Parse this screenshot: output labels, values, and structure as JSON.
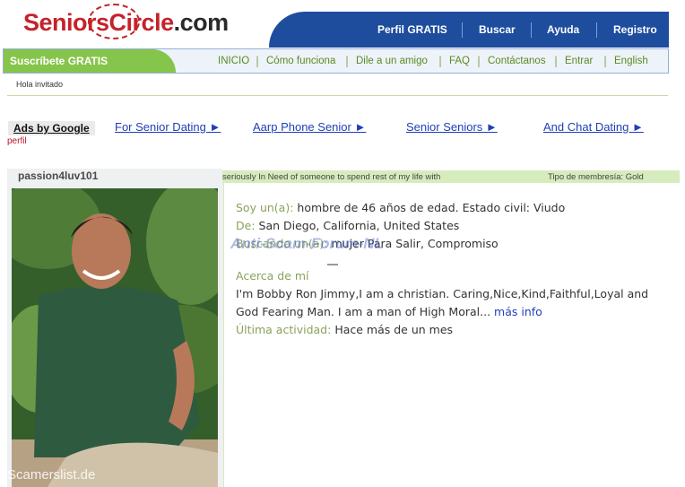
{
  "header": {
    "logo": {
      "part1": "Seniors",
      "part2": "Circle",
      "part3": ".com"
    },
    "nav": [
      {
        "label": "Perfil GRATIS"
      },
      {
        "label": "Buscar"
      },
      {
        "label": "Ayuda"
      },
      {
        "label": "Registro"
      }
    ]
  },
  "subnav": {
    "subscribe": "Suscríbete GRATIS",
    "items": [
      {
        "label": "INICIO"
      },
      {
        "label": "Cómo funciona"
      },
      {
        "label": "Dile a un amigo"
      },
      {
        "label": "FAQ"
      },
      {
        "label": "Contáctanos"
      },
      {
        "label": "Entrar"
      },
      {
        "label": "English"
      }
    ],
    "separator": "|"
  },
  "greeting": "Hola invitado",
  "ads": {
    "label": "Ads by Google",
    "links": [
      "For Senior Dating ►",
      "Aarp Phone Senior ►",
      "Senior Seniors ►",
      "And Chat Dating ►"
    ],
    "perfil": "perfil"
  },
  "profile": {
    "username": "passion4luv101",
    "headline": "seriously In Need of someone to spend rest of my life with",
    "membership": "Tipo de membresía: Gold",
    "soy_label": "Soy un(a):",
    "soy_value": "hombre de 46 años de edad. Estado civil: Viudo",
    "de_label": "De:",
    "de_value": "San Diego, California, United States",
    "busca_label": "Buscando un(a):",
    "busca_value": "mujer Para Salir, Compromiso",
    "about_label": "Acerca de mí",
    "about_text": "I'm Bobby Ron Jimmy,I am a christian. Caring,Nice,Kind,Faithful,Loyal and God Fearing Man. I am a man of High Moral...",
    "more_link": "más info",
    "actividad_label": "Última actividad:",
    "actividad_value": "Hace más de un mes"
  },
  "watermarks": {
    "forum": "Anti-Scam-Forum-NL",
    "site": "Scamerslist.de"
  },
  "colors": {
    "brand_red": "#c4232b",
    "nav_blue": "#1e4d9e",
    "subscribe_green": "#86c54b",
    "label_green": "#8aa35a",
    "link_blue": "#1f3fb8"
  }
}
